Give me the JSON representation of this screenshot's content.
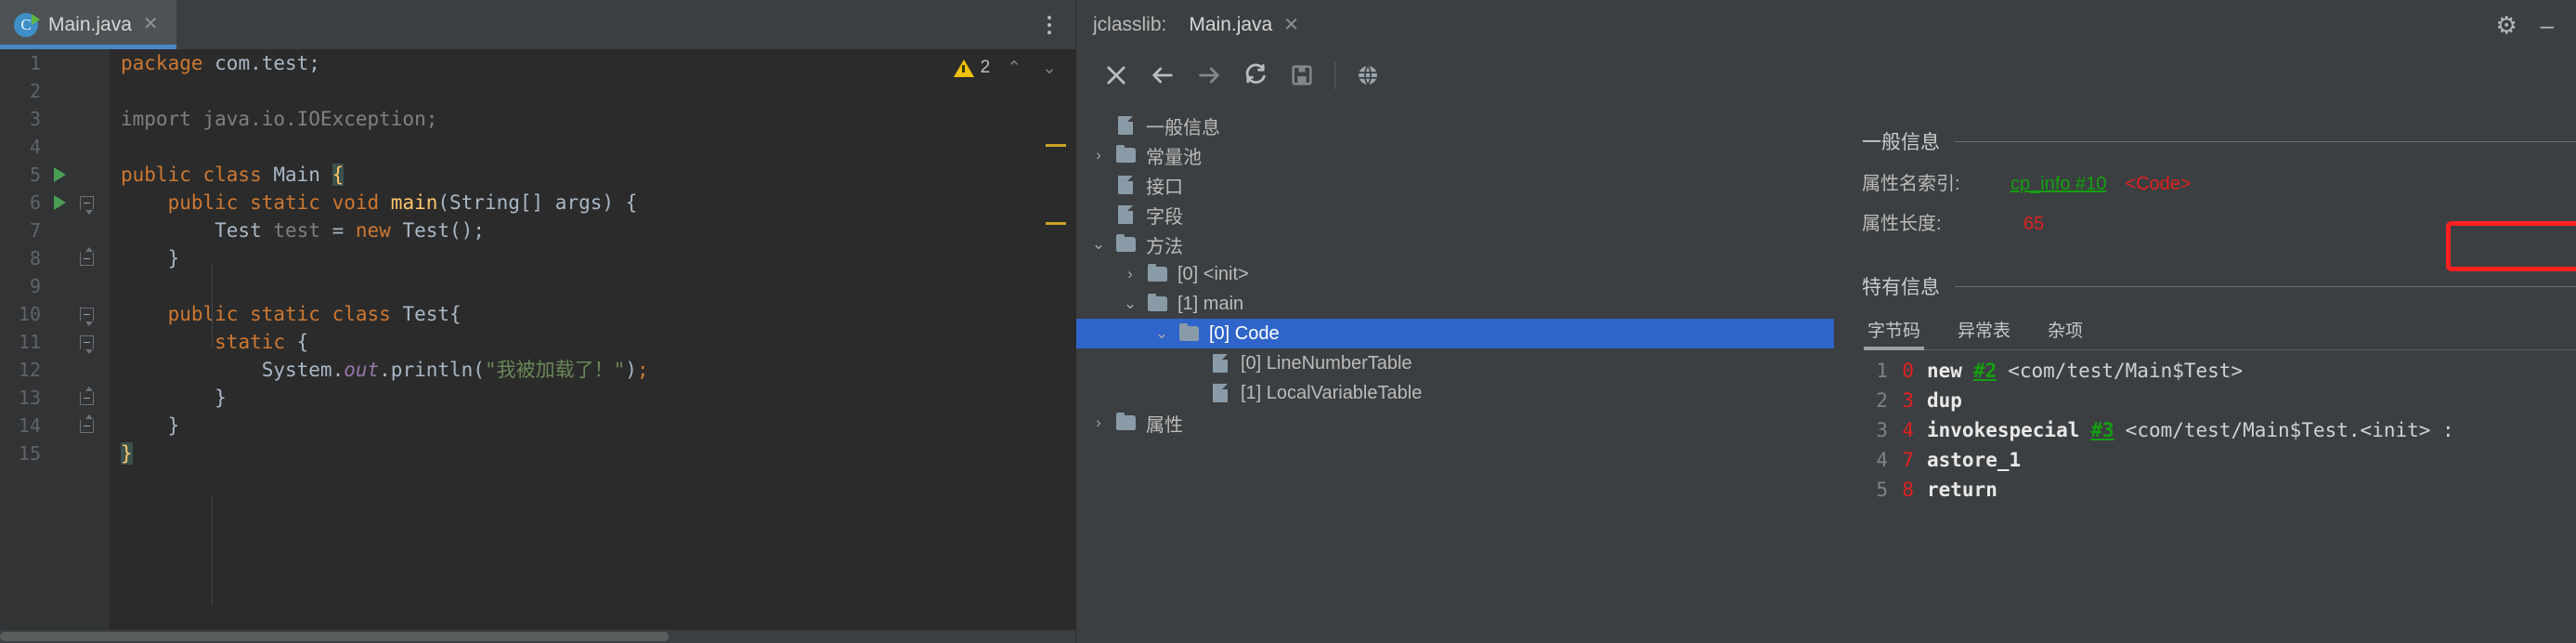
{
  "editor": {
    "tab": {
      "title": "Main.java",
      "close_label": "✕",
      "icon": "java-class-runnable-icon"
    },
    "kebab_label": "more-options",
    "inspection": {
      "warning_icon": "warning-triangle-icon",
      "warning_count": "2",
      "prev_label": "⌃",
      "next_label": "⌄"
    },
    "lines": [
      {
        "n": "1",
        "run": false,
        "fold": "",
        "tokens": [
          {
            "t": "package ",
            "c": "kw"
          },
          {
            "t": "com.test;",
            "c": "plain"
          }
        ]
      },
      {
        "n": "2",
        "run": false,
        "fold": "",
        "tokens": []
      },
      {
        "n": "3",
        "run": false,
        "fold": "",
        "tokens": [
          {
            "t": "import java.io.IOException;",
            "c": "grey"
          }
        ]
      },
      {
        "n": "4",
        "run": false,
        "fold": "",
        "tokens": []
      },
      {
        "n": "5",
        "run": true,
        "fold": "",
        "tokens": [
          {
            "t": "public class ",
            "c": "kw"
          },
          {
            "t": "Main ",
            "c": "plain"
          },
          {
            "t": "{",
            "c": "brace-hl"
          }
        ]
      },
      {
        "n": "6",
        "run": true,
        "fold": "open",
        "tokens": [
          {
            "t": "    ",
            "c": "plain"
          },
          {
            "t": "public static void ",
            "c": "kw"
          },
          {
            "t": "main",
            "c": "mth"
          },
          {
            "t": "(String[] args) {",
            "c": "plain"
          }
        ]
      },
      {
        "n": "7",
        "run": false,
        "fold": "",
        "tokens": [
          {
            "t": "        Test ",
            "c": "plain"
          },
          {
            "t": "test",
            "c": "grey"
          },
          {
            "t": " = ",
            "c": "plain"
          },
          {
            "t": "new ",
            "c": "kw"
          },
          {
            "t": "Test();",
            "c": "plain"
          }
        ]
      },
      {
        "n": "8",
        "run": false,
        "fold": "close",
        "tokens": [
          {
            "t": "    }",
            "c": "plain"
          }
        ]
      },
      {
        "n": "9",
        "run": false,
        "fold": "",
        "tokens": []
      },
      {
        "n": "10",
        "run": false,
        "fold": "open",
        "tokens": [
          {
            "t": "    ",
            "c": "plain"
          },
          {
            "t": "public static class ",
            "c": "kw"
          },
          {
            "t": "Test{",
            "c": "plain"
          }
        ]
      },
      {
        "n": "11",
        "run": false,
        "fold": "open",
        "tokens": [
          {
            "t": "        ",
            "c": "plain"
          },
          {
            "t": "static ",
            "c": "kw"
          },
          {
            "t": "{",
            "c": "plain"
          }
        ]
      },
      {
        "n": "12",
        "run": false,
        "fold": "",
        "tokens": [
          {
            "t": "            System.",
            "c": "plain"
          },
          {
            "t": "out",
            "c": "fld"
          },
          {
            "t": ".println(",
            "c": "plain"
          },
          {
            "t": "\"我被加载了！\"",
            "c": "str"
          },
          {
            "t": ")",
            "c": "plain"
          },
          {
            "t": ";",
            "c": "kw"
          }
        ]
      },
      {
        "n": "13",
        "run": false,
        "fold": "close",
        "tokens": [
          {
            "t": "        }",
            "c": "plain"
          }
        ]
      },
      {
        "n": "14",
        "run": false,
        "fold": "close",
        "tokens": [
          {
            "t": "    }",
            "c": "plain"
          }
        ]
      },
      {
        "n": "15",
        "run": false,
        "fold": "",
        "tokens": [
          {
            "t": "}",
            "c": "brace-hl"
          }
        ]
      }
    ]
  },
  "toolwindow": {
    "label": "jclasslib:",
    "tab_title": "Main.java",
    "tab_close": "✕",
    "settings_icon": "gear-icon",
    "minimize_icon": "minimize-icon",
    "toolbar": [
      {
        "name": "close-button",
        "glyph": "✕"
      },
      {
        "name": "back-button",
        "glyph": "←"
      },
      {
        "name": "forward-button",
        "glyph": "→"
      },
      {
        "name": "reload-button",
        "glyph": "↻"
      },
      {
        "name": "save-button",
        "glyph": "💾"
      },
      {
        "name": "browse-web-button",
        "glyph": "🌐"
      }
    ],
    "tree": [
      {
        "label": "一般信息",
        "indent": 0,
        "arrow": "",
        "icon": "file",
        "selected": false
      },
      {
        "label": "常量池",
        "indent": 0,
        "arrow": "›",
        "icon": "folder",
        "selected": false
      },
      {
        "label": "接口",
        "indent": 0,
        "arrow": "",
        "icon": "file",
        "selected": false
      },
      {
        "label": "字段",
        "indent": 0,
        "arrow": "",
        "icon": "file",
        "selected": false
      },
      {
        "label": "方法",
        "indent": 0,
        "arrow": "⌄",
        "icon": "folder",
        "selected": false
      },
      {
        "label": "[0] <init>",
        "indent": 1,
        "arrow": "›",
        "icon": "folder",
        "selected": false
      },
      {
        "label": "[1] main",
        "indent": 1,
        "arrow": "⌄",
        "icon": "folder",
        "selected": false
      },
      {
        "label": "[0] Code",
        "indent": 2,
        "arrow": "⌄",
        "icon": "folder",
        "selected": true
      },
      {
        "label": "[0] LineNumberTable",
        "indent": 3,
        "arrow": "",
        "icon": "file",
        "selected": false
      },
      {
        "label": "[1] LocalVariableTable",
        "indent": 3,
        "arrow": "",
        "icon": "file",
        "selected": false
      },
      {
        "label": "属性",
        "indent": 0,
        "arrow": "›",
        "icon": "folder",
        "selected": false
      }
    ],
    "detail": {
      "general_title": "一般信息",
      "attr_name_key": "属性名索引:",
      "attr_name_link": "cp_info #10",
      "attr_name_value": "<Code>",
      "attr_len_key": "属性长度:",
      "attr_len_value": "65",
      "specific_title": "特有信息",
      "bc_tabs": [
        {
          "label": "字节码",
          "active": true
        },
        {
          "label": "异常表",
          "active": false
        },
        {
          "label": "杂项",
          "active": false
        }
      ],
      "bytecode": [
        {
          "line": "1",
          "offset": "0",
          "op": "new",
          "ref": "#2",
          "arg": "<com/test/Main$Test>"
        },
        {
          "line": "2",
          "offset": "3",
          "op": "dup",
          "ref": "",
          "arg": ""
        },
        {
          "line": "3",
          "offset": "4",
          "op": "invokespecial",
          "ref": "#3",
          "arg": "<com/test/Main$Test.<init> : "
        },
        {
          "line": "4",
          "offset": "7",
          "op": "astore_1",
          "ref": "",
          "arg": ""
        },
        {
          "line": "5",
          "offset": "8",
          "op": "return",
          "ref": "",
          "arg": ""
        }
      ]
    }
  },
  "annotation": {
    "name": "red-highlight-box",
    "color": "#ff2020"
  }
}
